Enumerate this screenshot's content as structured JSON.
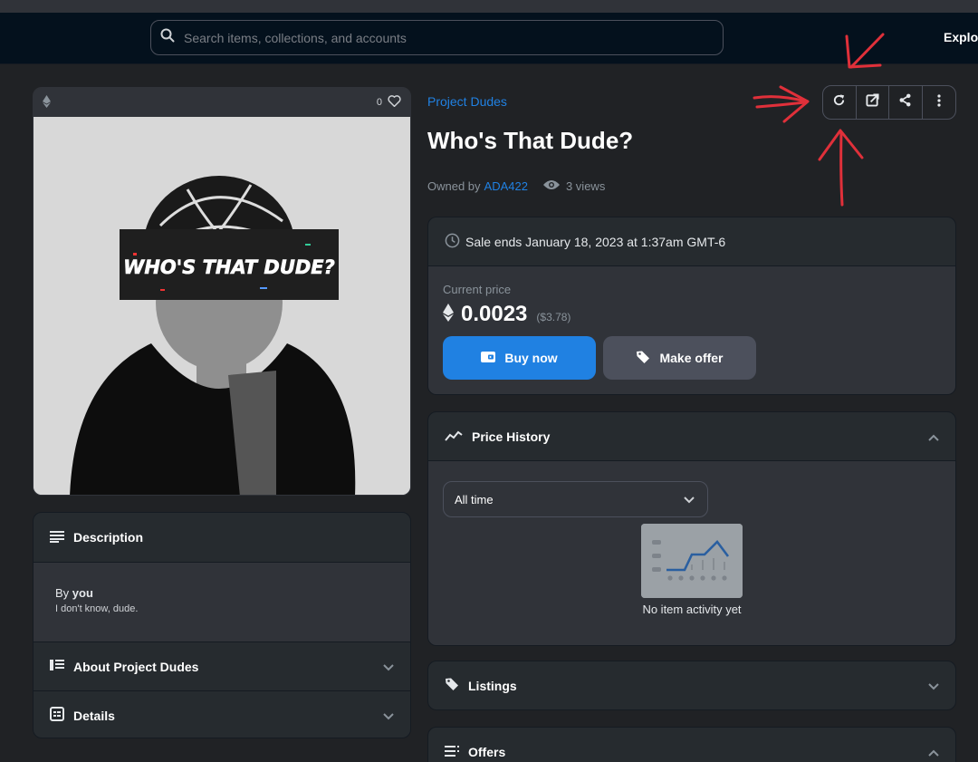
{
  "navbar": {
    "search_placeholder": "Search items, collections, and accounts",
    "explore_label": "Explor"
  },
  "media": {
    "chain_icon": "ethereum-icon",
    "favorites_count": "0",
    "artwork_text": "WHO'S THAT DUDE?"
  },
  "item": {
    "collection": "Project Dudes",
    "title": "Who's That Dude?",
    "owned_by_label": "Owned by",
    "owner": "ADA422",
    "views": "3 views"
  },
  "toolbar": {
    "icons": [
      "refresh-icon",
      "external-link-icon",
      "share-icon",
      "more-icon"
    ]
  },
  "sale": {
    "ends_text": "Sale ends January 18, 2023 at 1:37am GMT-6",
    "current_price_label": "Current price",
    "price": "0.0023",
    "usd": "($3.78)",
    "buy_label": "Buy now",
    "offer_label": "Make offer"
  },
  "price_history": {
    "title": "Price History",
    "range": "All time",
    "empty_text": "No item activity yet"
  },
  "listings": {
    "title": "Listings"
  },
  "offers": {
    "title": "Offers"
  },
  "description": {
    "title": "Description",
    "by_prefix": "By",
    "by_user": "you",
    "text": "I don't know, dude.",
    "about_title": "About Project Dudes",
    "details_title": "Details"
  },
  "colors": {
    "accent": "#2081e2",
    "background": "#202225",
    "panel": "#262b2f",
    "annotation": "#e0303a"
  }
}
